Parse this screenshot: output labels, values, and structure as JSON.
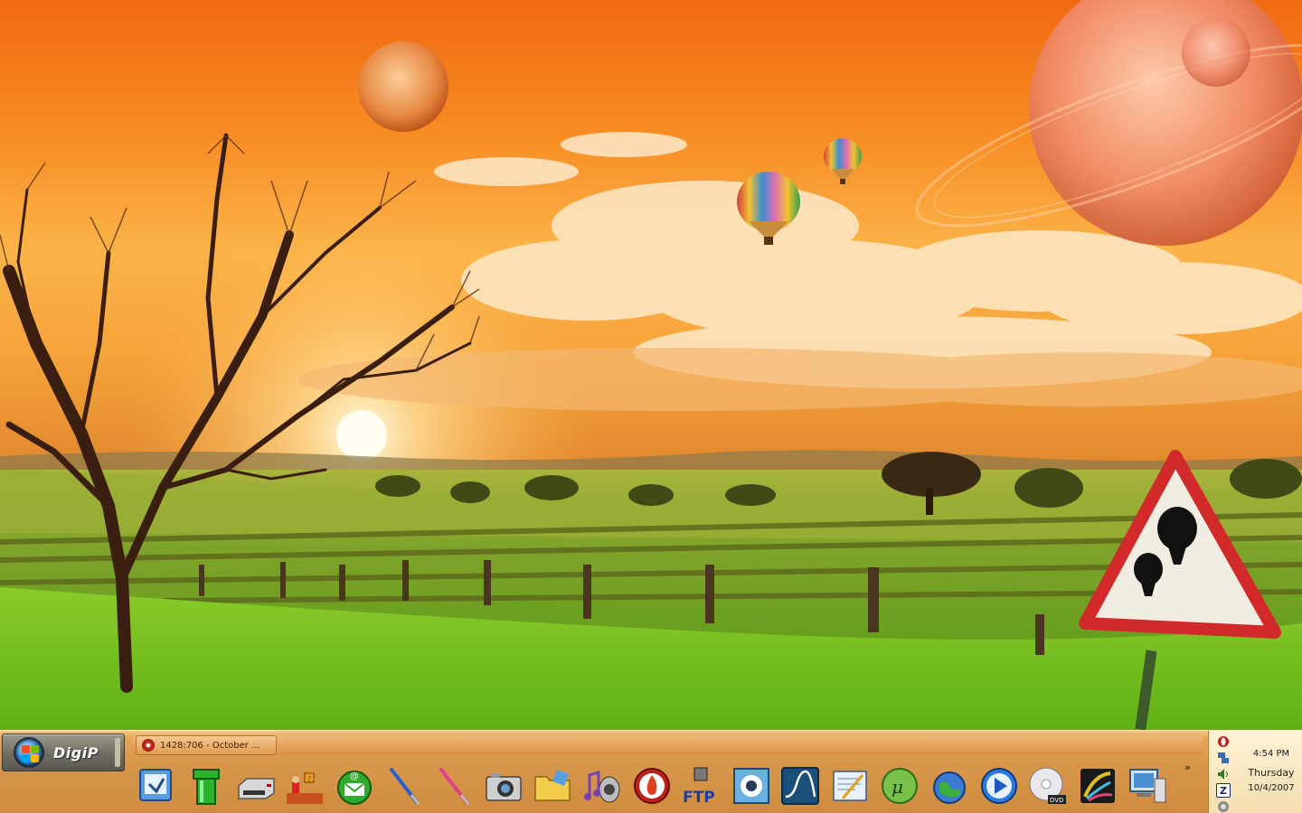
{
  "desktop": {
    "wallpaper": "hot-air-balloons-sunset-landscape"
  },
  "start_menu": {
    "label": "DigiP",
    "icon": "windows-orb-icon"
  },
  "taskbar": {
    "tasks": [
      {
        "label": "1428:706 - October ...",
        "icon": "opera-icon"
      }
    ],
    "quick_launch": [
      {
        "name": "desktop-tool-icon"
      },
      {
        "name": "green-pipe-icon"
      },
      {
        "name": "nes-console-icon"
      },
      {
        "name": "mario-game-icon"
      },
      {
        "name": "email-icon"
      },
      {
        "name": "blue-brush-icon"
      },
      {
        "name": "pink-brush-icon"
      },
      {
        "name": "camera-icon"
      },
      {
        "name": "folder-icon"
      },
      {
        "name": "music-speaker-icon"
      },
      {
        "name": "burner-flame-icon"
      },
      {
        "name": "ftp-client-icon"
      },
      {
        "name": "image-viewer-icon"
      },
      {
        "name": "waveform-icon"
      },
      {
        "name": "text-editor-icon"
      },
      {
        "name": "utorrent-icon"
      },
      {
        "name": "network-globe-icon"
      },
      {
        "name": "media-player-icon"
      },
      {
        "name": "dvd-disc-icon"
      },
      {
        "name": "paint-art-icon"
      },
      {
        "name": "remote-desktop-icon"
      }
    ],
    "overflow": "»"
  },
  "tray": {
    "icons": [
      {
        "name": "opera-tray-icon"
      },
      {
        "name": "network-tray-icon"
      },
      {
        "name": "volume-tray-icon"
      },
      {
        "name": "zonealarm-tray-icon",
        "glyph": "Z"
      },
      {
        "name": "security-tray-icon"
      }
    ],
    "time": "4:54 PM",
    "day": "Thursday",
    "date": "10/4/2007"
  }
}
